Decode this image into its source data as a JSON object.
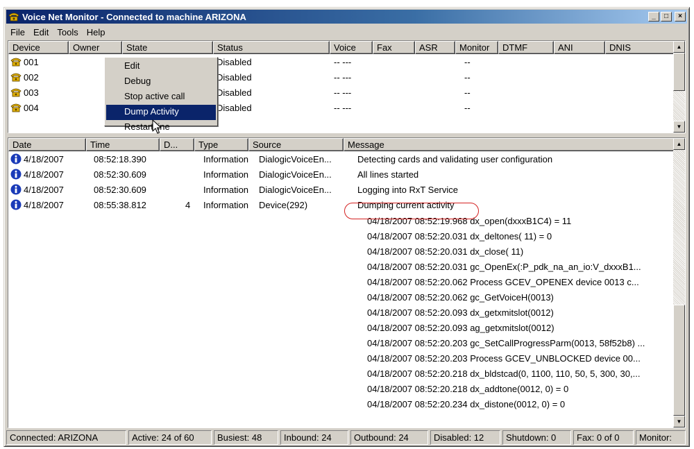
{
  "window": {
    "title": "Voice Net Monitor - Connected to machine ARIZONA",
    "controls": {
      "minimize": "_",
      "maximize": "□",
      "close": "×"
    }
  },
  "menubar": [
    "File",
    "Edit",
    "Tools",
    "Help"
  ],
  "devices": {
    "headers": [
      "Device",
      "Owner",
      "State",
      "Status",
      "Voice",
      "Fax",
      "ASR",
      "Monitor",
      "DTMF",
      "ANI",
      "DNIS"
    ],
    "rows": [
      {
        "device": "001",
        "status": "Disabled",
        "voice": "-- ---",
        "monitor": "--"
      },
      {
        "device": "002",
        "status": "Disabled",
        "voice": "-- ---",
        "monitor": "--"
      },
      {
        "device": "003",
        "status": "Disabled",
        "voice": "-- ---",
        "monitor": "--"
      },
      {
        "device": "004",
        "status": "Disabled",
        "voice": "-- ---",
        "monitor": "--"
      }
    ]
  },
  "context_menu": {
    "items": [
      "Edit",
      "Debug",
      "Stop active call",
      "Dump Activity",
      "Restart line"
    ],
    "selected": "Dump Activity"
  },
  "log": {
    "headers": [
      "Date",
      "Time",
      "D...",
      "Type",
      "Source",
      "Message"
    ],
    "rows": [
      {
        "date": "4/18/2007",
        "time": "08:52:18.390",
        "d": "",
        "type": "Information",
        "source": "DialogicVoiceEn...",
        "message": "Detecting cards and validating user configuration"
      },
      {
        "date": "4/18/2007",
        "time": "08:52:30.609",
        "d": "",
        "type": "Information",
        "source": "DialogicVoiceEn...",
        "message": "All lines started"
      },
      {
        "date": "4/18/2007",
        "time": "08:52:30.609",
        "d": "",
        "type": "Information",
        "source": "DialogicVoiceEn...",
        "message": "Logging into RxT Service"
      },
      {
        "date": "4/18/2007",
        "time": "08:55:38.812",
        "d": "4",
        "type": "Information",
        "source": "Device(292)",
        "message": "Dumping current activity"
      }
    ],
    "details": [
      "04/18/2007 08:52:19.968 dx_open(dxxxB1C4) =   11",
      "04/18/2007 08:52:20.031 dx_deltones( 11) = 0",
      "04/18/2007 08:52:20.031 dx_close( 11)",
      "04/18/2007 08:52:20.031 gc_OpenEx(:P_pdk_na_an_io:V_dxxxB1...",
      "04/18/2007 08:52:20.062 Process GCEV_OPENEX device 0013 c...",
      "04/18/2007 08:52:20.062 gc_GetVoiceH(0013)",
      "04/18/2007 08:52:20.093 dx_getxmitslot(0012)",
      "04/18/2007 08:52:20.093 ag_getxmitslot(0012)",
      "04/18/2007 08:52:20.203 gc_SetCallProgressParm(0013, 58f52b8) ...",
      "04/18/2007 08:52:20.203 Process GCEV_UNBLOCKED device 00...",
      "04/18/2007 08:52:20.218 dx_bldstcad(0, 1100, 110, 50, 5, 300, 30,...",
      "04/18/2007 08:52:20.218 dx_addtone(0012, 0) = 0",
      "04/18/2007 08:52:20.234 dx_distone(0012, 0) = 0"
    ]
  },
  "statusbar": [
    "Connected: ARIZONA",
    "Active: 24 of 60",
    "Busiest: 48",
    "Inbound: 24",
    "Outbound: 24",
    "Disabled: 12",
    "Shutdown: 0",
    "Fax: 0 of 0",
    "Monitor:"
  ],
  "colors": {
    "title_gradient_start": "#0a246a",
    "selection": "#0a246a",
    "info_icon": "#1a3bb8",
    "phone_icon": "#e0b000",
    "highlight_circle": "#d42020"
  },
  "icons": {
    "app": "phone-icon",
    "device": "phone-icon",
    "log": "info-icon",
    "cursor": "mouse-pointer-icon"
  }
}
